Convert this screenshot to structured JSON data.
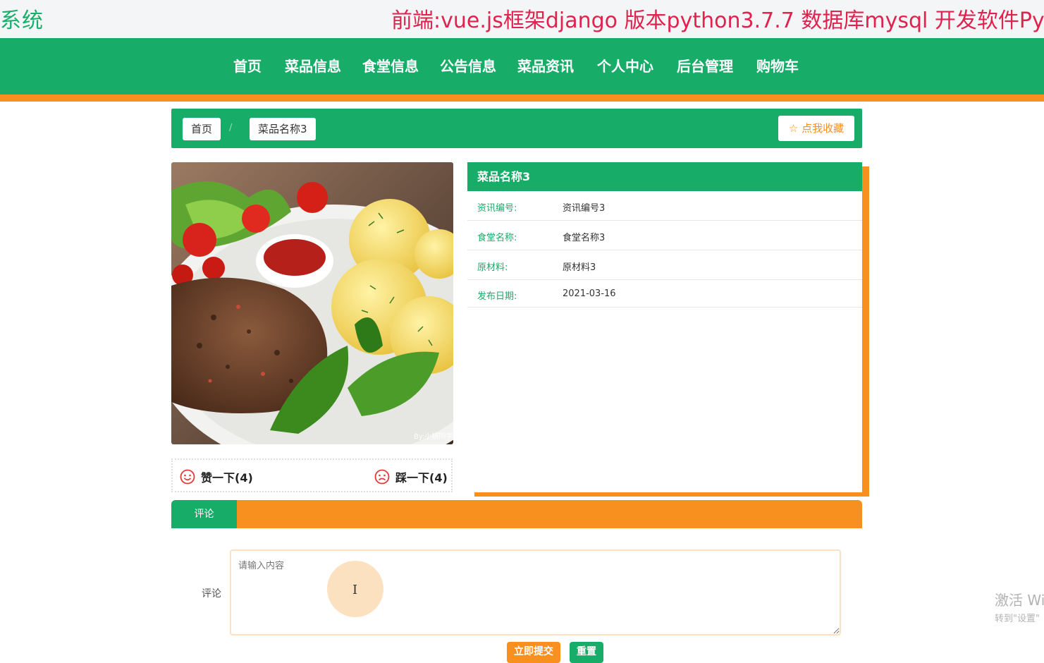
{
  "header": {
    "system_label": "系统",
    "banner": "前端:vue.js框架django 版本python3.7.7 数据库mysql  开发软件Py"
  },
  "nav": {
    "items": [
      "首页",
      "菜品信息",
      "食堂信息",
      "公告信息",
      "菜品资讯",
      "个人中心",
      "后台管理",
      "购物车"
    ]
  },
  "breadcrumb": {
    "home": "首页",
    "separator": "/",
    "current": "菜品名称3",
    "favorite_label": "点我收藏"
  },
  "photo": {
    "watermark": "By:小妍同学"
  },
  "votes": {
    "like_label": "赞一下(4)",
    "dislike_label": "踩一下(4)"
  },
  "detail": {
    "title": "菜品名称3",
    "rows": [
      {
        "label": "资讯编号:",
        "value": "资讯编号3"
      },
      {
        "label": "食堂名称:",
        "value": "食堂名称3"
      },
      {
        "label": "原材料:",
        "value": "原材料3"
      },
      {
        "label": "发布日期:",
        "value": "2021-03-16"
      }
    ]
  },
  "tabs": {
    "comment": "评论"
  },
  "comment_form": {
    "label": "评论",
    "placeholder": "请输入内容",
    "submit_label": "立即提交",
    "reset_label": "重置"
  },
  "os_watermark": {
    "line1": "激活 Wi",
    "line2": "转到\"设置\""
  },
  "colors": {
    "green": "#17ad69",
    "orange": "#f7901e",
    "banner_red": "#e0224e"
  }
}
